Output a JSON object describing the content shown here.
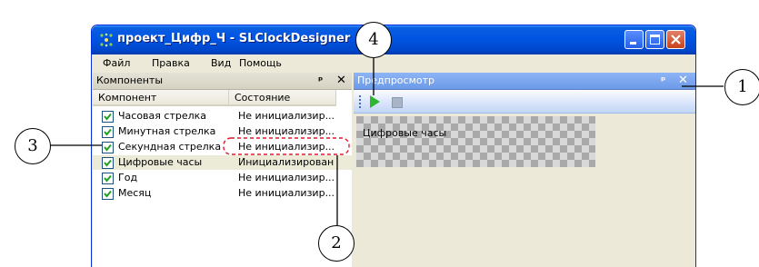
{
  "window": {
    "title": "проект_Цифр_Ч - SLClockDesigner"
  },
  "menu": [
    "Файл",
    "Правка",
    "Вид",
    "Помощь"
  ],
  "components_panel": {
    "title": "Компоненты",
    "pin": "ᵖ",
    "close": "✕",
    "columns": {
      "component": "Компонент",
      "state": "Состояние"
    },
    "rows": [
      {
        "name": "Часовая стрелка",
        "state": "Не инициализир..."
      },
      {
        "name": "Минутная стрелка",
        "state": "Не инициализир..."
      },
      {
        "name": "Секундная стрелка",
        "state": "Не инициализир..."
      },
      {
        "name": "Цифровые часы",
        "state": "Инициализирован"
      },
      {
        "name": "Год",
        "state": "Не инициализир..."
      },
      {
        "name": "Месяц",
        "state": "Не инициализир..."
      }
    ]
  },
  "preview_panel": {
    "title": "Предпросмотр",
    "pin": "ᵖ",
    "close": "✕",
    "canvas_label": "Цифровые часы"
  },
  "callouts": [
    "1",
    "2",
    "3",
    "4"
  ],
  "colors": {
    "title_bar": "#0054e3",
    "preview_header": "#7aa6ee",
    "callout_dash": "#e0182c",
    "play": "#2fb52f"
  }
}
